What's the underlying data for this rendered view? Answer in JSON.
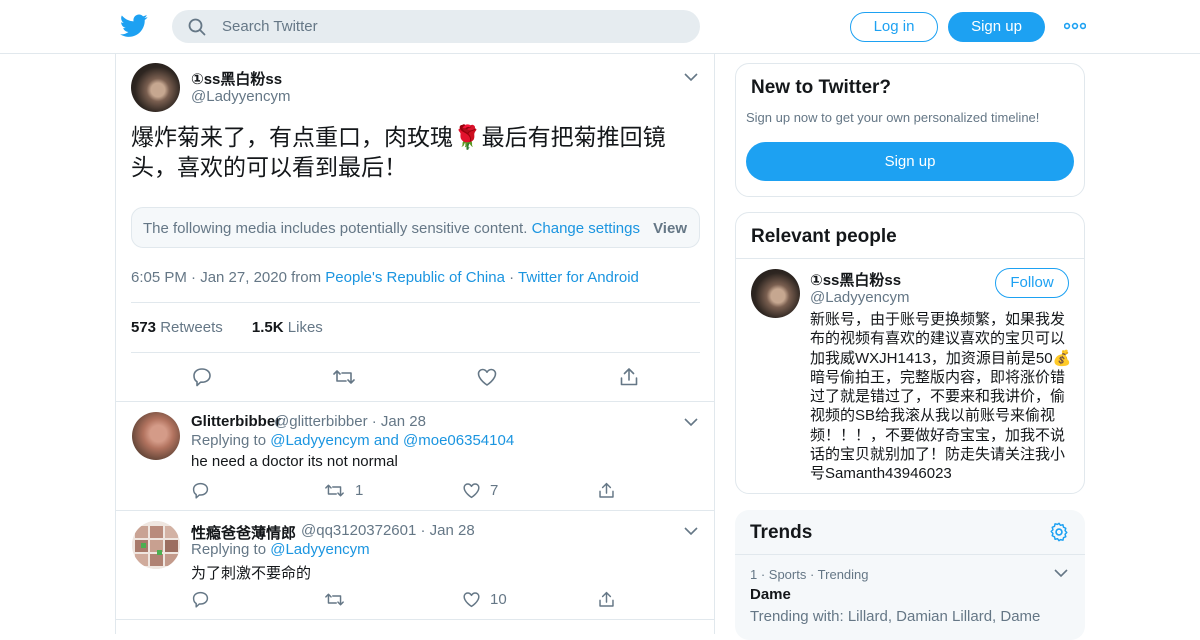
{
  "header": {
    "search_placeholder": "Search Twitter",
    "login_label": "Log in",
    "signup_label": "Sign up"
  },
  "tweet": {
    "author_name": "①ss黑白粉ss",
    "author_handle": "@Ladyyencym",
    "text": "爆炸菊来了，有点重口，肉玫瑰🌹最后有把菊推回镜头，喜欢的可以看到最后！",
    "sensitive_message": "The following media includes potentially sensitive content.",
    "change_settings": "Change settings",
    "view_label": "View",
    "time": "6:05 PM · Jan 27, 2020 from",
    "location": "People's Republic of China",
    "separator": "·",
    "client": "Twitter for Android",
    "retweets_count": "573",
    "retweets_label": "Retweets",
    "likes_count": "1.5K",
    "likes_label": "Likes"
  },
  "replies": [
    {
      "name": "Glitterbibber",
      "handle_date": "@glitterbibber · Jan 28",
      "replying_label": "Replying to",
      "replying_to": "@Ladyyencym and @moe06354104",
      "text": "he need a doctor its not normal",
      "retweets": "1",
      "likes": "7"
    },
    {
      "name": "性瘾爸爸薄情郎",
      "handle_date": "@qq3120372601 · Jan 28",
      "replying_label": "Replying to",
      "replying_to": "@Ladyyencym",
      "text": "为了刺激不要命的",
      "retweets": "",
      "likes": "10"
    }
  ],
  "new_to_twitter": {
    "title": "New to Twitter?",
    "subtitle": "Sign up now to get your own personalized timeline!",
    "button": "Sign up"
  },
  "relevant_people": {
    "title": "Relevant people",
    "name": "①ss黑白粉ss",
    "handle": "@Ladyyencym",
    "follow_label": "Follow",
    "bio": "新账号，由于账号更换频繁，如果我发布的视频有喜欢的建议喜欢的宝贝可以加我威WXJH1413，加资源目前是50💰暗号偷拍王，完整版内容，即将涨价错过了就是错过了，不要来和我讲价，偷视频的SB给我滚从我以前账号来偷视频！！！，不要做好奇宝宝，加我不说话的宝贝就别加了！防走失请关注我小号Samanth43946023"
  },
  "trends": {
    "title": "Trends",
    "items": [
      {
        "meta": "1 · Sports · Trending",
        "name": "Dame",
        "with": "Trending with: Lillard, Damian Lillard, Dame"
      }
    ]
  },
  "colors": {
    "brand": "#1da1f2",
    "link": "#1b95e0",
    "secondary_text": "#657786",
    "border": "#e1e8ed"
  }
}
